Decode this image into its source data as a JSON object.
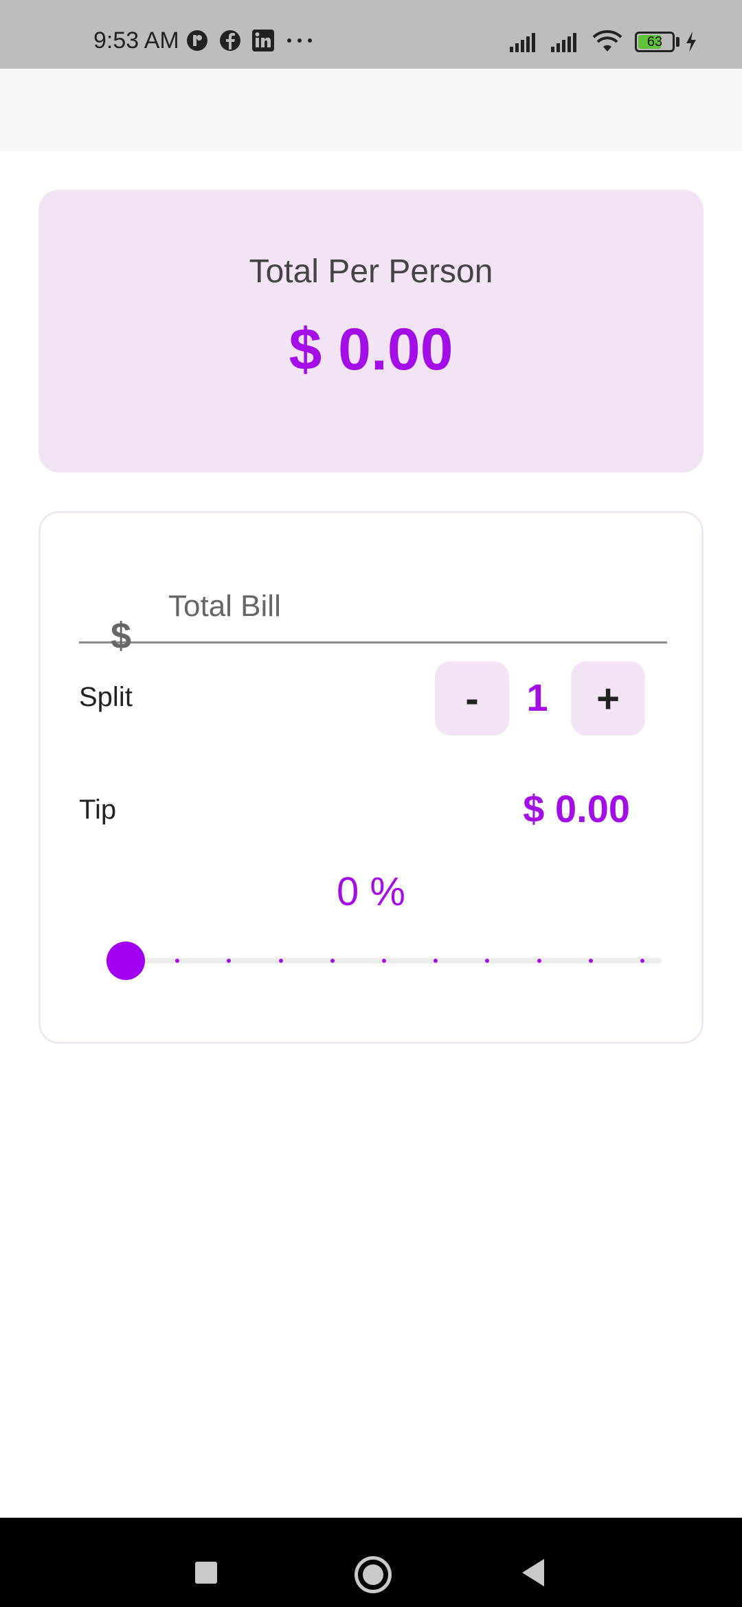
{
  "status_bar": {
    "time": "9:53 AM",
    "battery_level": "63",
    "icons": [
      "notification-app-icon",
      "facebook-icon",
      "linkedin-icon",
      "more-dots-icon",
      "signal-icon",
      "signal-icon",
      "wifi-icon",
      "battery-icon",
      "charging-icon"
    ]
  },
  "summary": {
    "label": "Total Per Person",
    "amount": "$ 0.00"
  },
  "bill": {
    "prefix": "$",
    "placeholder": "Total Bill",
    "value": ""
  },
  "split": {
    "label": "Split",
    "minus_label": "-",
    "plus_label": "+",
    "value": "1"
  },
  "tip": {
    "label": "Tip",
    "amount": "$ 0.00",
    "percent_text": "0 %",
    "slider": {
      "value": 0,
      "min": 0,
      "max": 100,
      "steps": 10
    }
  },
  "colors": {
    "accent": "#a30ee6",
    "card_bg": "#f2e4f4"
  }
}
